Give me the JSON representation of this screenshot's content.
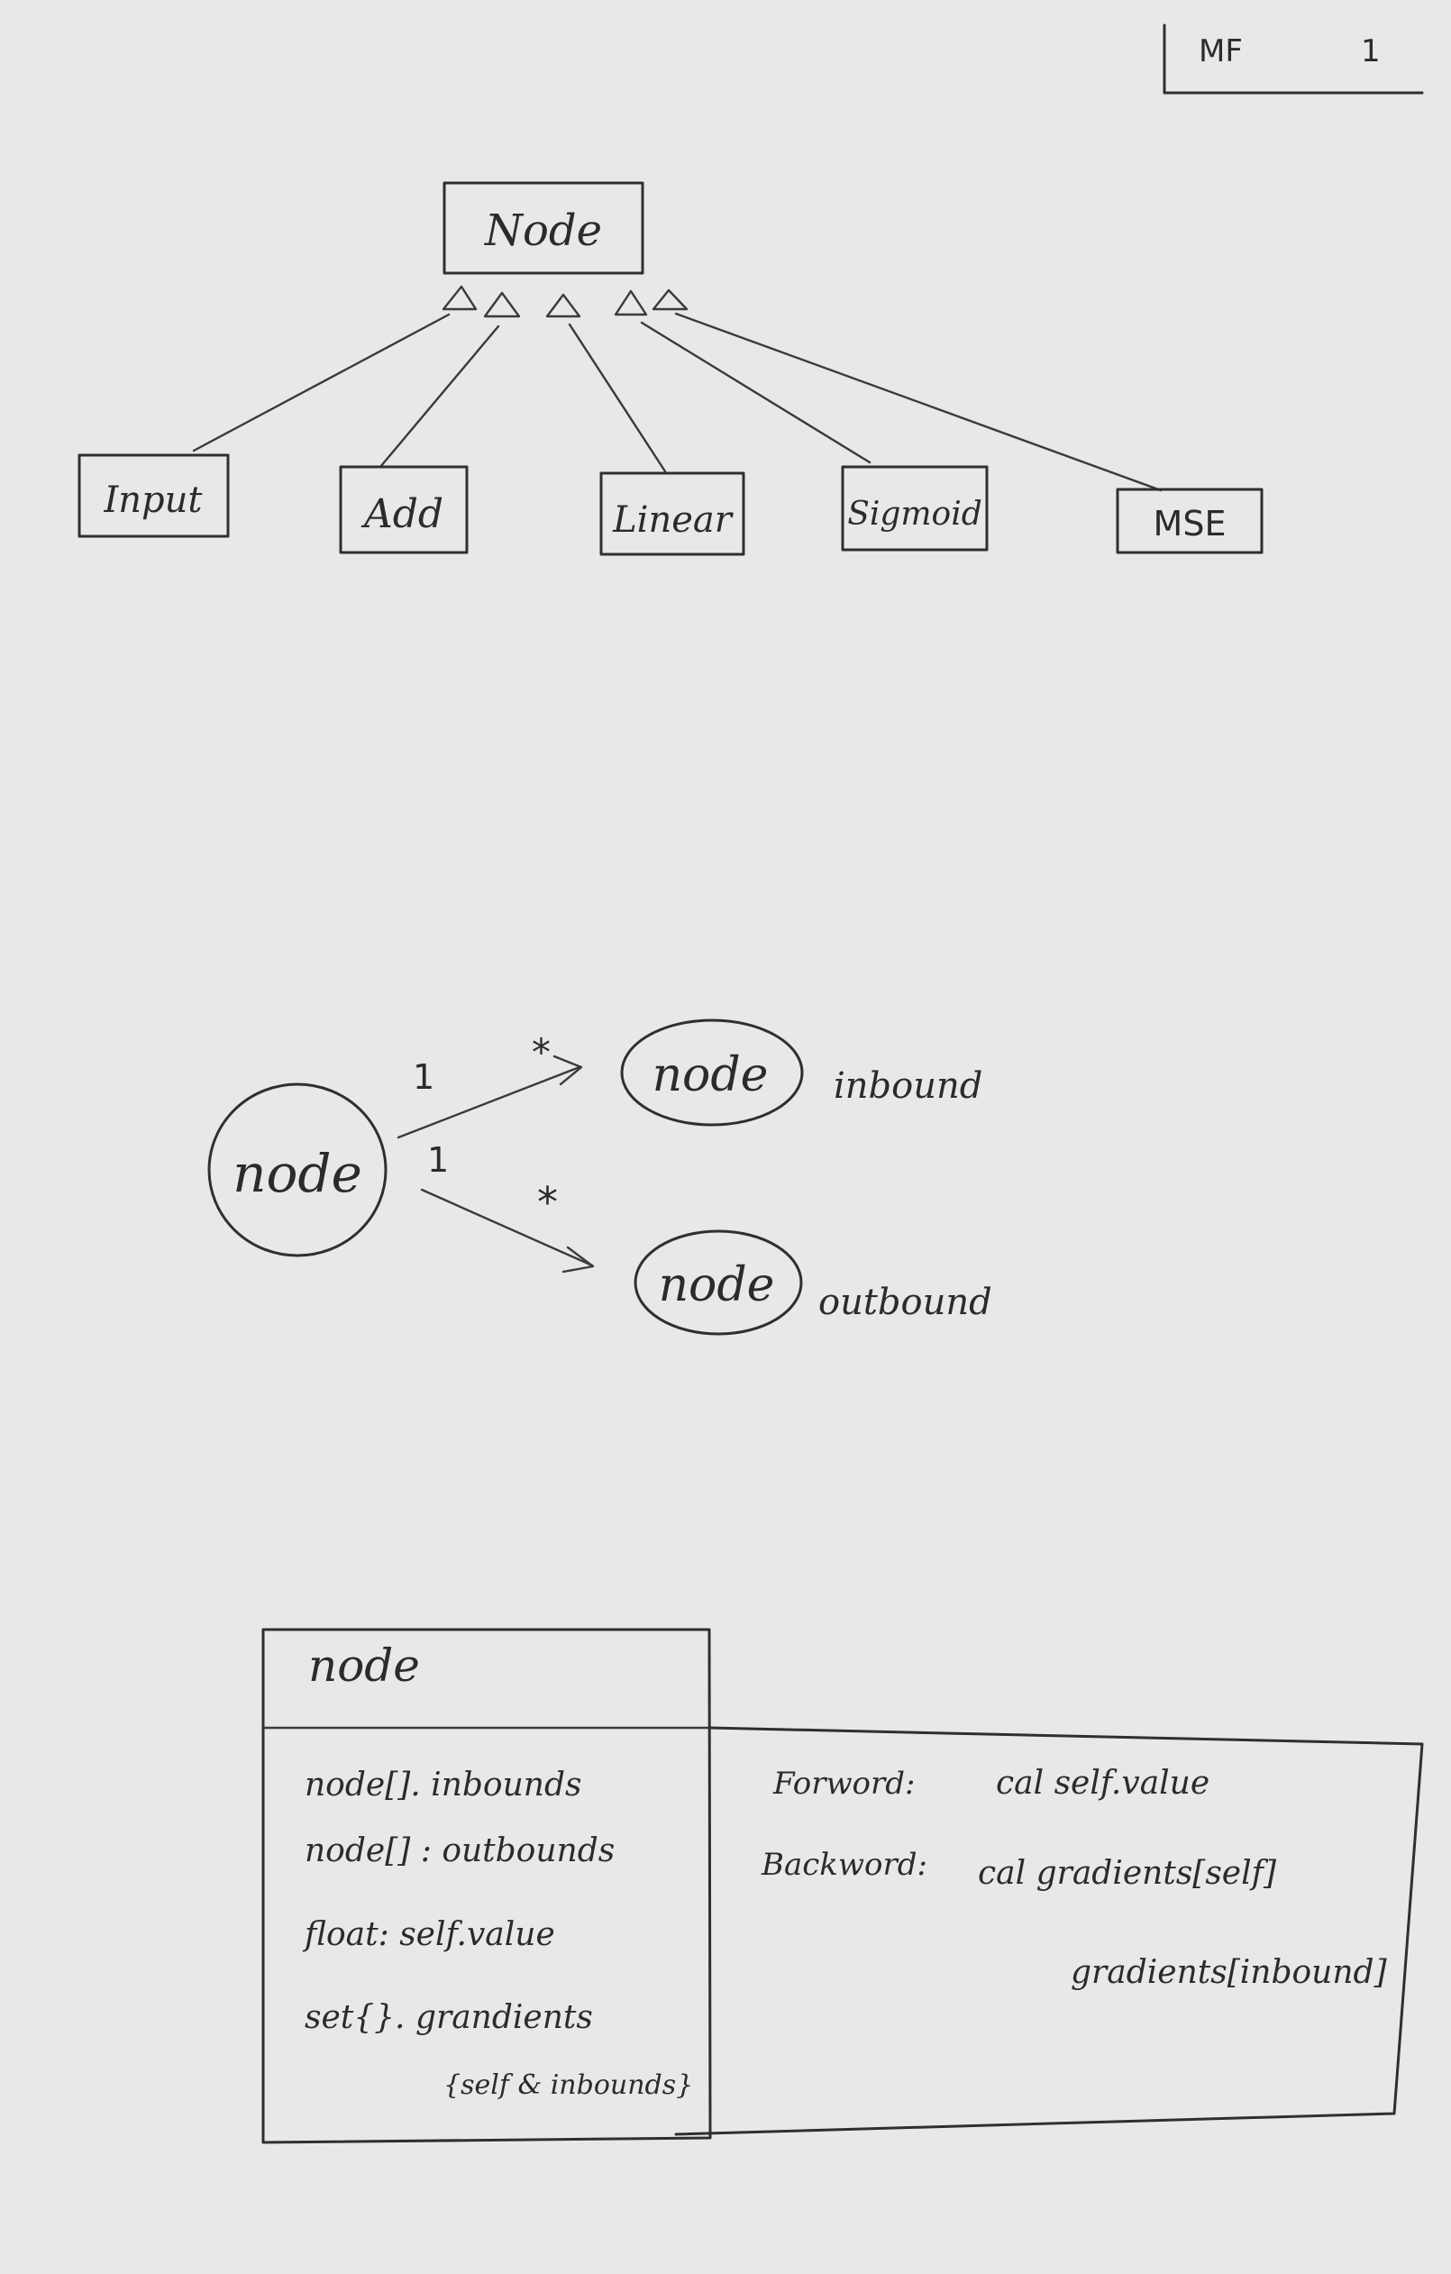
{
  "page_tag": {
    "code": "MF",
    "number": "1"
  },
  "hierarchy": {
    "parent": "Node",
    "children": [
      "Input",
      "Add",
      "Linear",
      "Sigmoid",
      "MSE"
    ]
  },
  "association": {
    "source": "node",
    "inbound_target": "node",
    "inbound_label": "inbound",
    "outbound_target": "node",
    "outbound_label": "outbound",
    "mult_source": "1",
    "mult_target": "*"
  },
  "class_box": {
    "name": "node",
    "attributes": [
      "node[]. inbounds",
      "node[] : outbounds",
      "float: self.value",
      "set{}. grandients",
      "{self & inbounds}"
    ]
  },
  "methods": {
    "forward_label": "Forword:",
    "forward_text": "cal  self.value",
    "backward_label": "Backword:",
    "backward_text": "cal  gradients[self]",
    "backward_text2": "gradients[inbound]"
  }
}
